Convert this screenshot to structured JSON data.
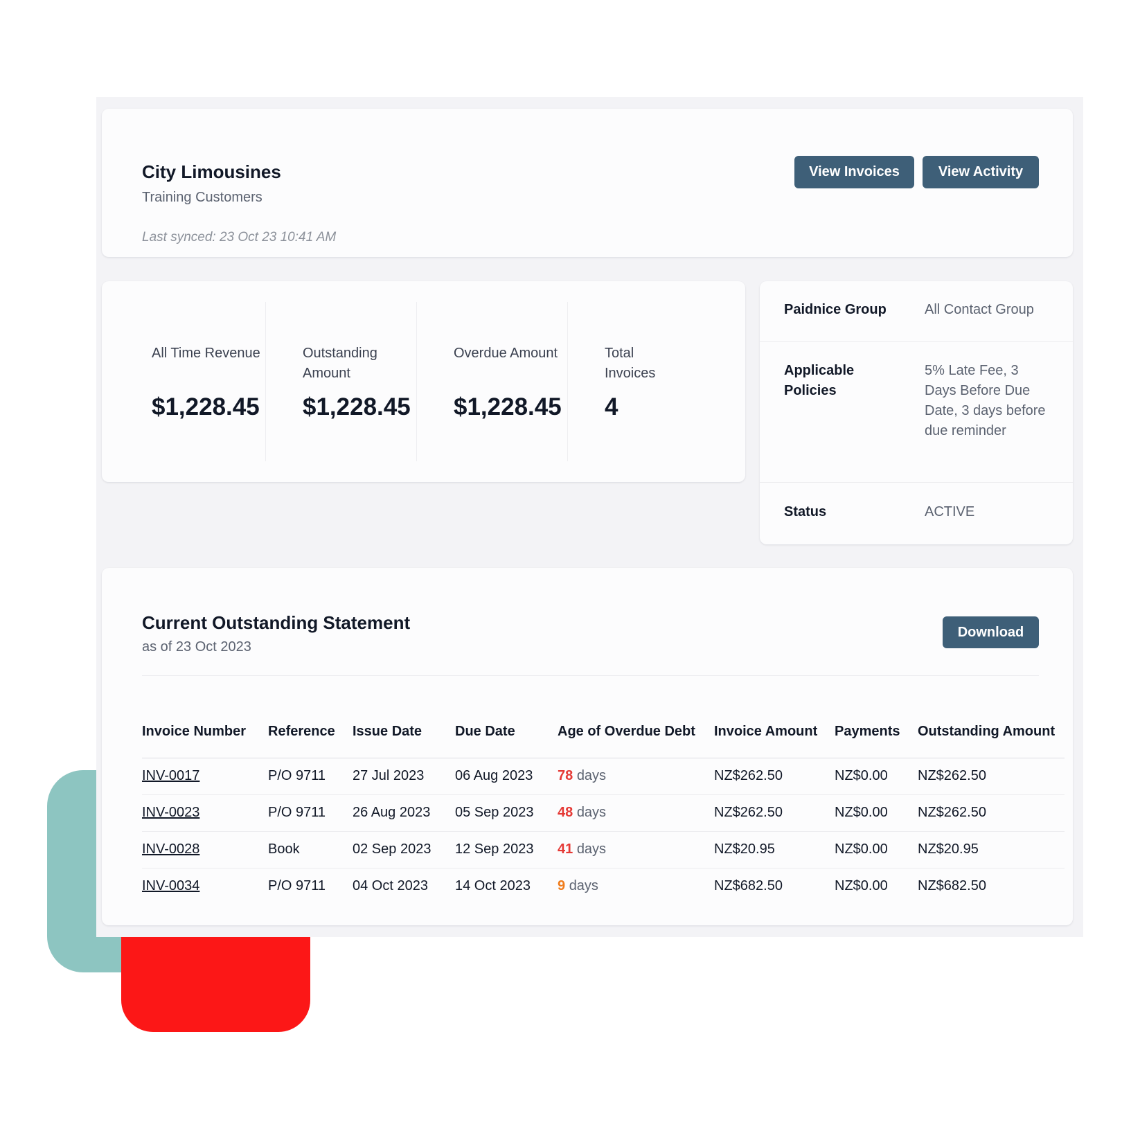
{
  "header": {
    "company_name": "City Limousines",
    "company_group": "Training Customers",
    "last_synced": "Last synced: 23 Oct 23 10:41 AM",
    "buttons": {
      "view_invoices": "View Invoices",
      "view_activity": "View Activity"
    }
  },
  "stats": [
    {
      "label": "All Time Revenue",
      "value": "$1,228.45"
    },
    {
      "label": "Outstanding Amount",
      "value": "$1,228.45"
    },
    {
      "label": "Overdue Amount",
      "value": "$1,228.45"
    },
    {
      "label": "Total Invoices",
      "value": "4"
    }
  ],
  "info": {
    "paidnice_group": {
      "label": "Paidnice Group",
      "value": "All Contact Group"
    },
    "applicable_policies": {
      "label": "Applicable Policies",
      "value": "5% Late Fee, 3 Days Before Due Date, 3 days before due reminder"
    },
    "status": {
      "label": "Status",
      "value": "ACTIVE"
    }
  },
  "statement": {
    "title": "Current Outstanding Statement",
    "subtitle": "as of 23 Oct 2023",
    "download_label": "Download",
    "columns": [
      "Invoice Number",
      "Reference",
      "Issue Date",
      "Due Date",
      "Age of Overdue Debt",
      "Invoice Amount",
      "Payments",
      "Outstanding Amount"
    ],
    "rows": [
      {
        "invoice_number": "INV-0017",
        "reference": "P/O 9711",
        "issue_date": "27 Jul 2023",
        "due_date": "06 Aug 2023",
        "age_days": "78",
        "age_unit": "days",
        "age_color": "#e53935",
        "invoice_amount": "NZ$262.50",
        "payments": "NZ$0.00",
        "outstanding_amount": "NZ$262.50"
      },
      {
        "invoice_number": "INV-0023",
        "reference": "P/O 9711",
        "issue_date": "26 Aug 2023",
        "due_date": "05 Sep 2023",
        "age_days": "48",
        "age_unit": "days",
        "age_color": "#e53935",
        "invoice_amount": "NZ$262.50",
        "payments": "NZ$0.00",
        "outstanding_amount": "NZ$262.50"
      },
      {
        "invoice_number": "INV-0028",
        "reference": "Book",
        "issue_date": "02 Sep 2023",
        "due_date": "12 Sep 2023",
        "age_days": "41",
        "age_unit": "days",
        "age_color": "#e53935",
        "invoice_amount": "NZ$20.95",
        "payments": "NZ$0.00",
        "outstanding_amount": "NZ$20.95"
      },
      {
        "invoice_number": "INV-0034",
        "reference": "P/O 9711",
        "issue_date": "04 Oct 2023",
        "due_date": "14 Oct 2023",
        "age_days": "9",
        "age_unit": "days",
        "age_color": "#f07c1b",
        "invoice_amount": "NZ$682.50",
        "payments": "NZ$0.00",
        "outstanding_amount": "NZ$682.50"
      }
    ]
  },
  "colors": {
    "button_bg": "#3e5f78",
    "decor_teal": "#8dc5c1",
    "decor_red": "#fc1717",
    "overdue_red": "#e53935",
    "overdue_orange": "#f07c1b"
  }
}
